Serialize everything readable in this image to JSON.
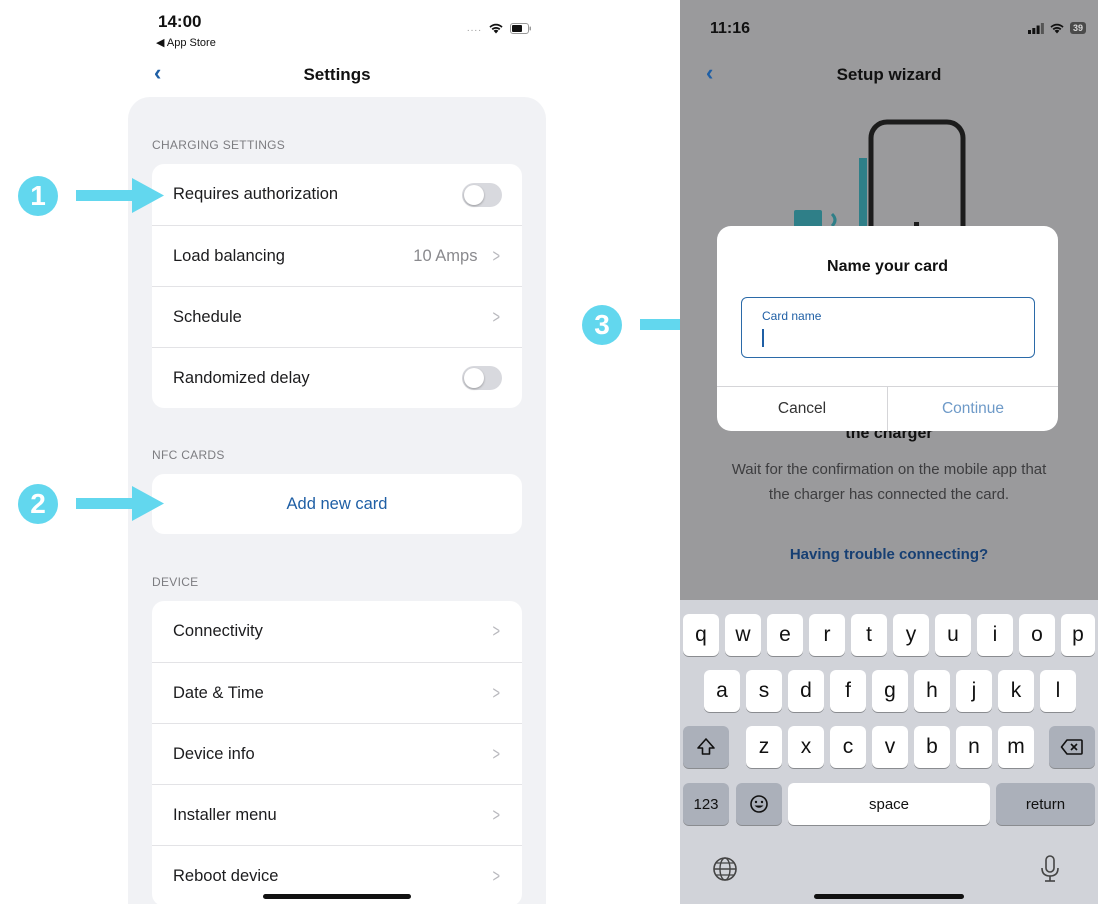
{
  "left": {
    "status": {
      "time": "14:00",
      "back_app": "◀ App Store",
      "signal_dots": "....",
      "wifi": "wifi-icon",
      "battery": "battery-icon"
    },
    "nav": {
      "back": "‹",
      "title": "Settings"
    },
    "sections": {
      "charging": {
        "header": "CHARGING SETTINGS",
        "rows": [
          {
            "label": "Requires authorization",
            "control": "toggle",
            "on": false
          },
          {
            "label": "Load balancing",
            "value": "10 Amps",
            "control": "chevron"
          },
          {
            "label": "Schedule",
            "control": "chevron"
          },
          {
            "label": "Randomized delay",
            "control": "toggle",
            "on": false
          }
        ]
      },
      "nfc": {
        "header": "NFC CARDS",
        "add_card": "Add new card"
      },
      "device": {
        "header": "DEVICE",
        "rows": [
          {
            "label": "Connectivity"
          },
          {
            "label": "Date & Time"
          },
          {
            "label": "Device info"
          },
          {
            "label": "Installer menu"
          },
          {
            "label": "Reboot device"
          }
        ]
      }
    }
  },
  "annotations": {
    "one": "1",
    "two": "2",
    "three": "3",
    "color": "#62d7ee"
  },
  "right": {
    "status": {
      "time": "11:16",
      "battery_level": "39"
    },
    "nav": {
      "back": "‹",
      "title": "Setup wizard"
    },
    "dialog": {
      "title": "Name your card",
      "field_label": "Card name",
      "field_value": "",
      "cancel": "Cancel",
      "continue": "Continue"
    },
    "behind": {
      "subtitle": "the charger",
      "body_line1": "Wait for the confirmation on the mobile app that",
      "body_line2": "the charger has connected the card.",
      "trouble": "Having trouble connecting?"
    },
    "keyboard": {
      "row1": [
        "q",
        "w",
        "e",
        "r",
        "t",
        "y",
        "u",
        "i",
        "o",
        "p"
      ],
      "row2": [
        "a",
        "s",
        "d",
        "f",
        "g",
        "h",
        "j",
        "k",
        "l"
      ],
      "row3": [
        "z",
        "x",
        "c",
        "v",
        "b",
        "n",
        "m"
      ],
      "shift": "⇧",
      "delete": "⌫",
      "numbers": "123",
      "emoji": "☺",
      "space": "space",
      "return": "return",
      "globe": "🌐",
      "mic": "mic-icon"
    }
  }
}
